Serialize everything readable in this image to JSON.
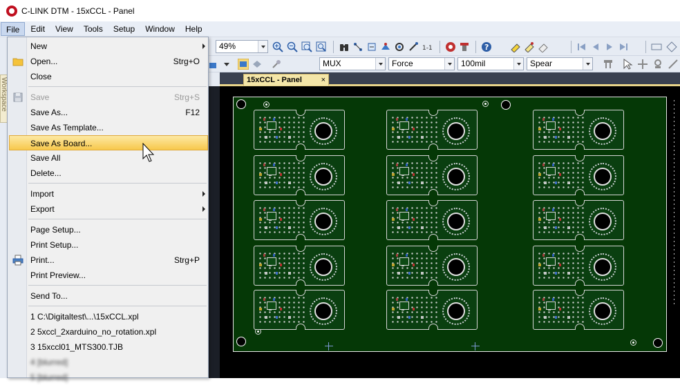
{
  "window": {
    "title": "C-LINK DTM - 15xCCL - Panel"
  },
  "menubar": [
    "File",
    "Edit",
    "View",
    "Tools",
    "Setup",
    "Window",
    "Help"
  ],
  "toolbar": {
    "zoom": "49%"
  },
  "toolbar2": {
    "combo1": "MUX",
    "combo2": "Force",
    "combo3": "100mil",
    "combo4": "Spear"
  },
  "document": {
    "tab_title": "15xCCL - Panel",
    "tab_close": "×"
  },
  "left_dock": {
    "workspace_label": "Workspace"
  },
  "file_menu": {
    "new": "New",
    "open": "Open...",
    "open_shortcut": "Strg+O",
    "close": "Close",
    "save": "Save",
    "save_shortcut": "Strg+S",
    "save_as": "Save As...",
    "save_as_shortcut": "F12",
    "save_as_template": "Save As Template...",
    "save_as_board": "Save As Board...",
    "save_all": "Save All",
    "delete": "Delete...",
    "import": "Import",
    "export": "Export",
    "page_setup": "Page Setup...",
    "print_setup": "Print Setup...",
    "print": "Print...",
    "print_shortcut": "Strg+P",
    "print_preview": "Print Preview...",
    "send_to": "Send To...",
    "recent": [
      "1 C:\\Digitaltest\\...\\15xCCL.xpl",
      "2 5xccl_2xarduino_no_rotation.xpl",
      "3 15xccl01_MTS300.TJB",
      "4 [blurred]",
      "5 [blurred]"
    ]
  },
  "colors": {
    "board": "#053806",
    "highlight": "#f7c84c",
    "menubar": "#e9eef6"
  }
}
